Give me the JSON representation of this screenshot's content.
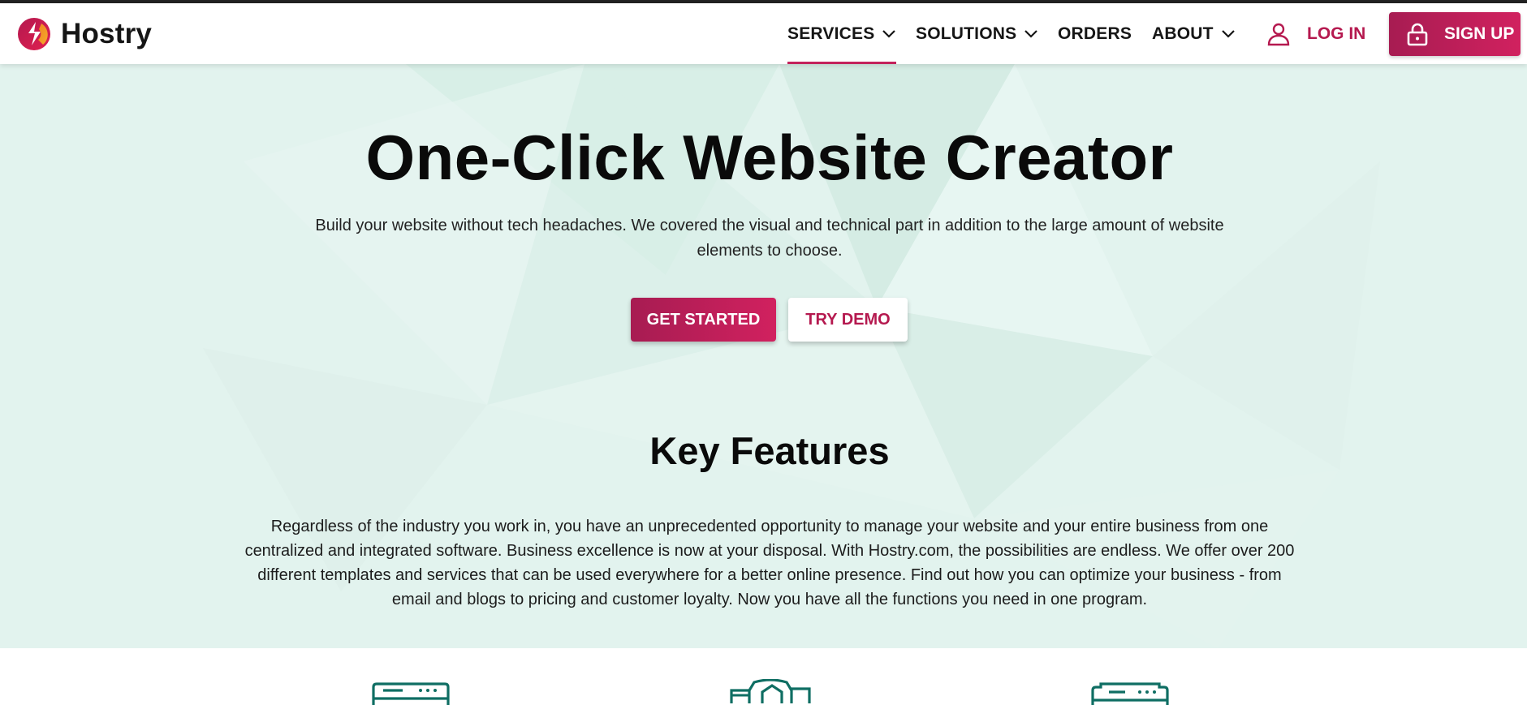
{
  "brand": {
    "name": "Hostry"
  },
  "nav": {
    "items": [
      {
        "label": "SERVICES",
        "has_dropdown": true,
        "active": true
      },
      {
        "label": "SOLUTIONS",
        "has_dropdown": true,
        "active": false
      },
      {
        "label": "ORDERS",
        "has_dropdown": false,
        "active": false
      },
      {
        "label": "ABOUT",
        "has_dropdown": true,
        "active": false
      }
    ],
    "login_label": "LOG IN",
    "signup_label": "SIGN UP"
  },
  "hero": {
    "title": "One-Click Website Creator",
    "subtitle": "Build your website without tech headaches. We covered the visual and technical part in addition to the large amount of website elements to choose.",
    "primary_cta": "GET STARTED",
    "secondary_cta": "TRY DEMO"
  },
  "key_features": {
    "title": "Key Features",
    "description": "Regardless of the industry you work in, you have an unprecedented opportunity to manage your website and your entire business from one centralized and integrated software. Business excellence is now at your disposal. With Hostry.com, the possibilities are endless. We offer over 200 different templates and services that can be used everywhere for a better online presence. Find out how you can optimize your business - from email and blogs to pricing and customer loyalty. Now you have all the functions you need in one program."
  },
  "feature_icons": [
    "browser-window-icon",
    "shop-buildings-icon",
    "browser-window-icon"
  ],
  "colors": {
    "accent": "#c3225b",
    "accent_gradient_start": "#a71c52",
    "accent_gradient_end": "#d1215f",
    "hero_background": "#e2f3ee",
    "icon_teal": "#0f6e63"
  }
}
